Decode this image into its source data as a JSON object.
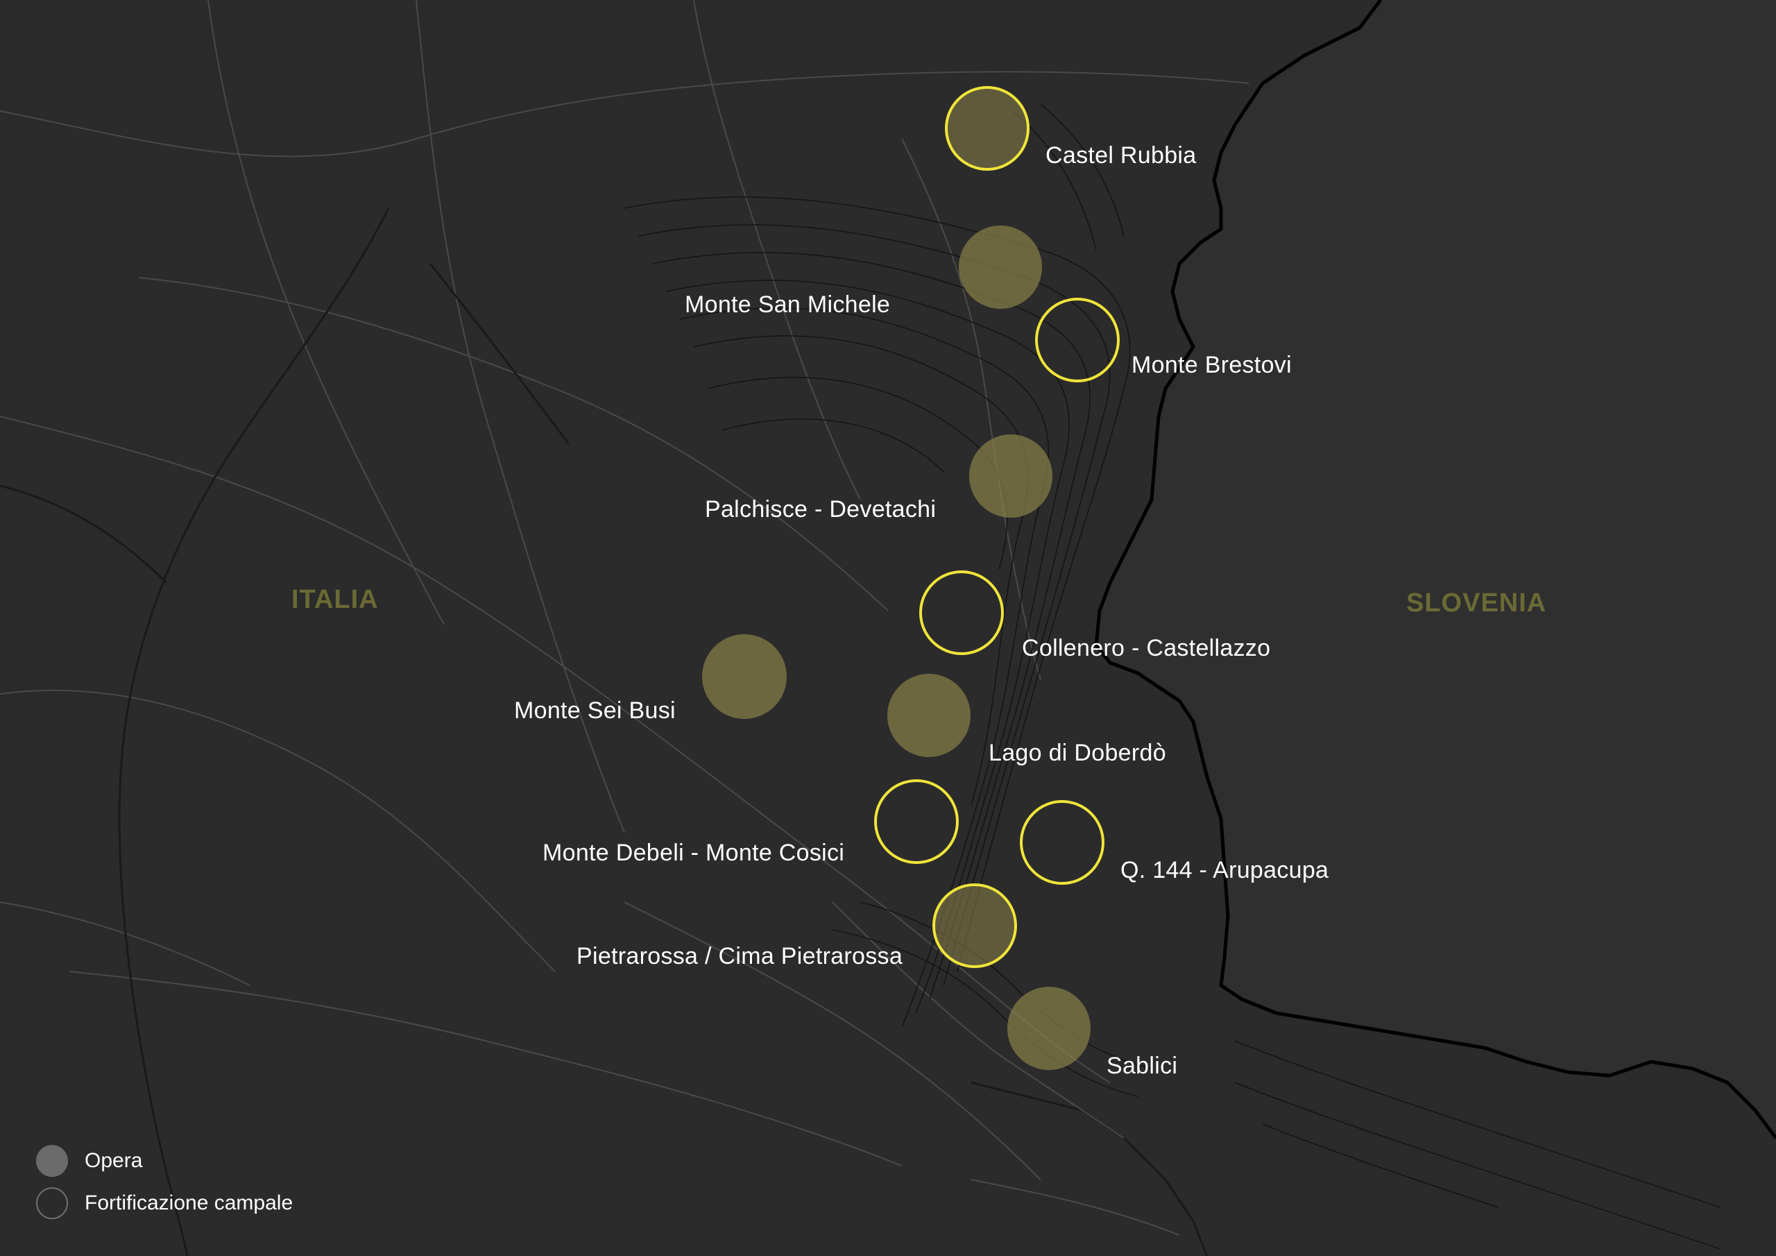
{
  "countries": {
    "left": "ITALIA",
    "right": "SLOVENIA"
  },
  "colors": {
    "background": "#2b2b2b",
    "accent": "#f0e43a",
    "opera_fill": "#8a8248",
    "country_label": "#6b6a35",
    "contours": "#111111",
    "roads": "#4a4a4a"
  },
  "sites": [
    {
      "name": "Castel Rubbia",
      "type": "fortificazione"
    },
    {
      "name": "Monte San Michele",
      "type": "opera"
    },
    {
      "name": "Monte Brestovi",
      "type": "fortificazione"
    },
    {
      "name": "Palchisce - Devetachi",
      "type": "opera"
    },
    {
      "name": "Collenero - Castellazzo",
      "type": "fortificazione"
    },
    {
      "name": "Monte Sei Busi",
      "type": "opera"
    },
    {
      "name": "Lago di Doberdò",
      "type": "opera"
    },
    {
      "name": "Monte Debeli - Monte Cosici",
      "type": "fortificazione"
    },
    {
      "name": "Q. 144 - Arupacupa",
      "type": "fortificazione"
    },
    {
      "name": "Pietrarossa / Cima Pietrarossa",
      "type": "fortificazione"
    },
    {
      "name": "Sablici",
      "type": "opera"
    }
  ],
  "legend": {
    "opera": "Opera",
    "fortificazione": "Fortificazione campale"
  }
}
